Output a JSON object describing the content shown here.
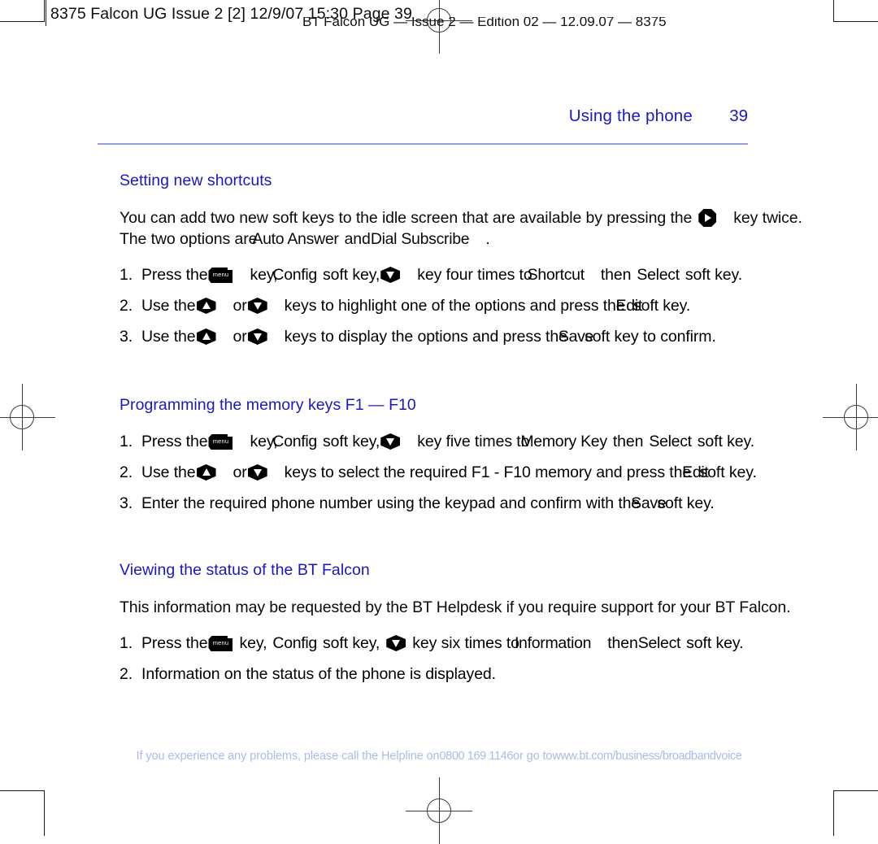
{
  "print_marks": {
    "job_slug": "8375 Falcon UG Issue 2 [2]  12/9/07  15:30  Page 39",
    "edition_line": "BT Falcon UG — Issue 2 — Edition 02 — 12.09.07 — 8375"
  },
  "running_head": {
    "title": "Using the phone",
    "folio": "39"
  },
  "sections": [
    {
      "heading": "Setting new shortcuts",
      "intro": {
        "part1": "You can add two new soft keys to the idle screen that are available by pressing the",
        "icon": "nav-right-key-icon",
        "part2": "key twice.",
        "part3": "The two options are",
        "term1": "Auto Answer",
        "conj": "and",
        "term2": "Dial Subscribe",
        "part4": "."
      },
      "steps": [
        {
          "num": "1.",
          "a": "Press the",
          "icon1": "menu-key-icon",
          "b": "key,",
          "term1": "Config",
          "c": "soft key,",
          "icon2": "down-key-icon",
          "d": "key four times to",
          "term2": "Shortcut",
          "e": "then",
          "term3": "Select",
          "f": "soft key."
        },
        {
          "num": "2.",
          "a": "Use the",
          "icon1": "up-key-icon",
          "b": "or",
          "icon2": "down-key-icon",
          "c": "keys to highlight one of the options and press the",
          "term1": "Edit",
          "d": "soft key."
        },
        {
          "num": "3.",
          "a": "Use the",
          "icon1": "up-key-icon",
          "b": "or",
          "icon2": "down-key-icon",
          "c": "keys to display the options and press the",
          "term1": "Save",
          "d": "soft key to confirm."
        }
      ]
    },
    {
      "heading": "Programming the memory keys F1 — F10",
      "steps": [
        {
          "num": "1.",
          "a": "Press the",
          "icon1": "menu-key-icon",
          "b": "key,",
          "term1": "Config",
          "c": "soft key,",
          "icon2": "down-key-icon",
          "d": "key five times to",
          "term2": "Memory Key",
          "e": "then",
          "term3": "Select",
          "f": "soft key."
        },
        {
          "num": "2.",
          "a": "Use the",
          "icon1": "up-key-icon",
          "b": "or",
          "icon2": "down-key-icon",
          "c": "keys to select the required F1 - F10 memory and press the",
          "term1": "Edit",
          "d": "soft key."
        },
        {
          "num": "3.",
          "a": "Enter the required phone number using the keypad and confirm with the",
          "term1": "Save",
          "d": "soft key."
        }
      ]
    },
    {
      "heading": "Viewing the status of the BT Falcon",
      "lead": "This information may be requested by the BT Helpdesk if you require support for your BT Falcon.",
      "steps": [
        {
          "num": "1.",
          "a": "Press the",
          "icon1": "menu-key-icon",
          "b": "key,",
          "term1": "Config",
          "c": "soft key,",
          "icon2": "down-key-icon",
          "d": "key six times to",
          "term2": "Information",
          "e": "then",
          "term3": "Select",
          "f": "soft key."
        },
        {
          "num": "2.",
          "a": "Information on the status of the phone is displayed."
        }
      ]
    }
  ],
  "footer": {
    "part1": "If you experience any problems, please call the Helpline on",
    "phone": "0800 169 1146",
    "part2": "or go to",
    "url": "www.bt.com/business/broadbandvoice"
  },
  "icon_labels": {
    "menu": "menu"
  },
  "colors": {
    "heading_blue": "#1a17c4",
    "rule_blue": "#9aa0e8",
    "footer_blue": "#a9bce8",
    "text_black": "#0a0a0a"
  }
}
